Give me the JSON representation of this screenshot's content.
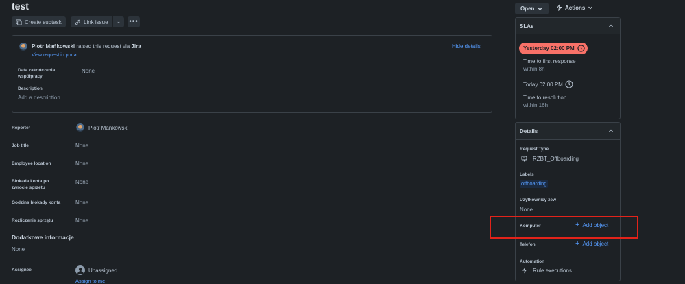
{
  "issue": {
    "title": "test"
  },
  "toolbar": {
    "create_subtask": "Create subtask",
    "link_issue": "Link issue"
  },
  "request": {
    "requester": "Piotr Mańkowski",
    "raised_text": "raised this request via",
    "channel": "Jira",
    "view_portal": "View request in portal",
    "hide_details": "Hide details",
    "fields": [
      {
        "label_line1": "Data zakończenia",
        "label_line2": "współpracy",
        "value": "None"
      }
    ],
    "description_label": "Description",
    "description_placeholder": "Add a description..."
  },
  "fields": [
    {
      "label": "Reporter",
      "value": "Piotr Mańkowski"
    },
    {
      "label": "Job title",
      "value": "None"
    },
    {
      "label": "Employee location",
      "value": "None"
    },
    {
      "label_line1": "Blokada konta po",
      "label_line2": "zwrocie sprzętu",
      "value": "None"
    },
    {
      "label": "Godzina blokady konta",
      "value": "None"
    },
    {
      "label": "Rozliczenie sprzętu",
      "value": "None"
    }
  ],
  "additional": {
    "heading": "Dodatkowe informacje",
    "value": "None"
  },
  "assignee": {
    "label": "Assignee",
    "value": "Unassigned",
    "assign_to_me": "Assign to me"
  },
  "status": {
    "open": "Open",
    "actions": "Actions"
  },
  "slas": {
    "heading": "SLAs",
    "first": {
      "time": "Yesterday 02:00 PM",
      "name": "Time to first response",
      "remaining": "within 8h"
    },
    "second": {
      "time": "Today 02:00 PM",
      "name": "Time to resolution",
      "remaining": "within 16h"
    }
  },
  "details": {
    "heading": "Details",
    "request_type_label": "Request Type",
    "request_type_value": "RZBT_Offboarding",
    "labels_label": "Labels",
    "labels_value": "offboarding",
    "uzytkownicy_label": "Uzytkownicy zew",
    "uzytkownicy_value": "None",
    "komputer_label": "Komputer",
    "komputer_action": "Add object",
    "telefon_label": "Telefon",
    "telefon_action": "Add object",
    "automation_label": "Automation",
    "automation_value": "Rule executions"
  },
  "colors": {
    "background": "#1d2125",
    "link": "#579dff",
    "sla_breached": "#f87168",
    "highlight_box": "#e2231a"
  }
}
